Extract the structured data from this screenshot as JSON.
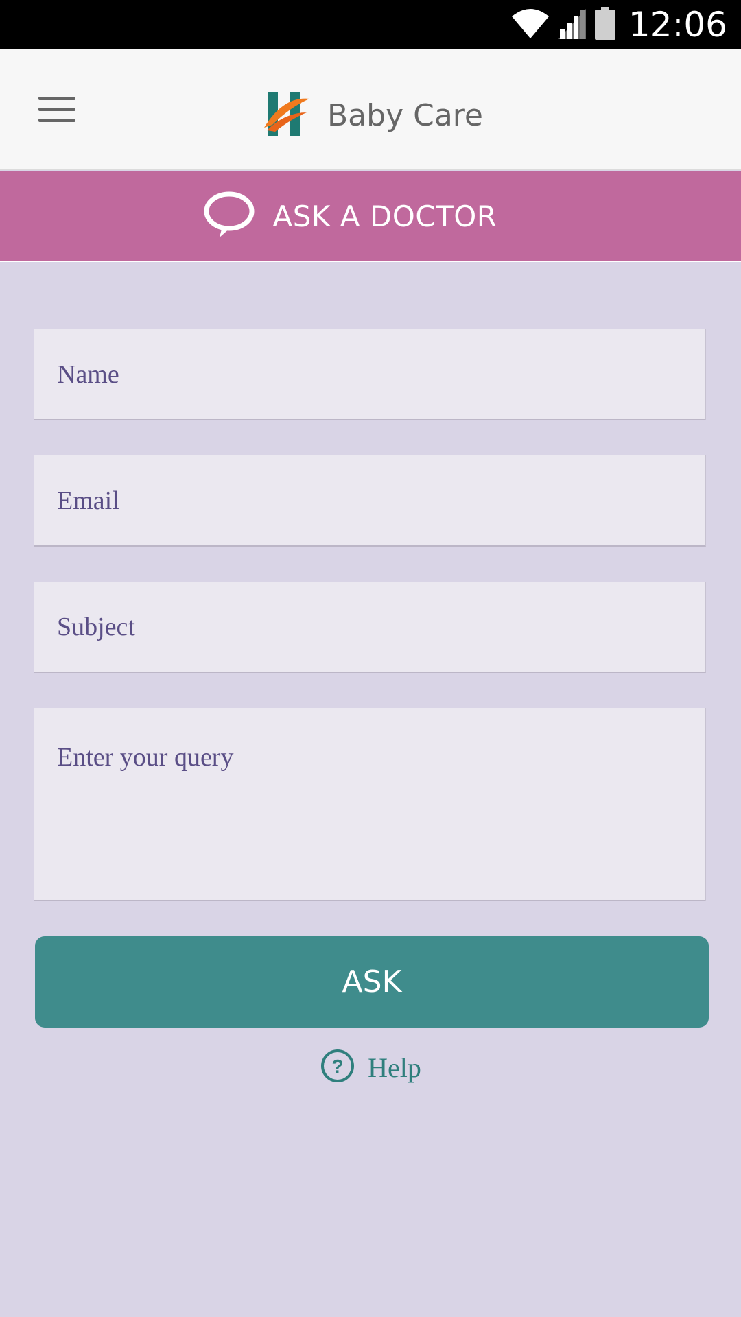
{
  "status_bar": {
    "time": "12:06",
    "icons": [
      "wifi-icon",
      "cellular-signal-icon",
      "battery-icon"
    ]
  },
  "app_bar": {
    "menu_icon": "hamburger-menu-icon",
    "logo": "h-logo",
    "title": "Baby Care"
  },
  "banner": {
    "icon": "speech-bubble-icon",
    "title": "ASK A DOCTOR"
  },
  "form": {
    "name_placeholder": "Name",
    "email_placeholder": "Email",
    "subject_placeholder": "Subject",
    "query_placeholder": "Enter your query"
  },
  "actions": {
    "ask_label": "ASK",
    "help_icon": "question-circle-icon",
    "help_label": "Help"
  },
  "colors": {
    "status_bar": "#000000",
    "app_bar": "#f7f7f7",
    "banner": "#c0699d",
    "background": "#d9d4e6",
    "field": "#ebe8f0",
    "placeholder_text": "#5a4e86",
    "ask_button": "#3f8c8c",
    "help_text": "#2f7f7d",
    "logo_teal": "#1f7a72",
    "logo_orange": "#f07a1e"
  }
}
